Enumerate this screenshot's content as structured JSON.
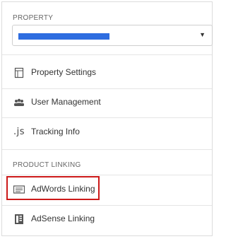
{
  "property_section": {
    "label": "PROPERTY",
    "selector_value": "",
    "items": [
      {
        "label": "Property Settings",
        "icon": "property-settings-icon"
      },
      {
        "label": "User Management",
        "icon": "users-icon"
      },
      {
        "label": "Tracking Info",
        "icon": "js-icon",
        "icon_text": ".js"
      }
    ]
  },
  "product_linking_section": {
    "label": "PRODUCT LINKING",
    "items": [
      {
        "label": "AdWords Linking",
        "icon": "adwords-icon",
        "highlighted": true
      },
      {
        "label": "AdSense Linking",
        "icon": "adsense-icon"
      }
    ]
  },
  "colors": {
    "highlight_border": "#cc1919",
    "redaction": "#2e6de0"
  }
}
